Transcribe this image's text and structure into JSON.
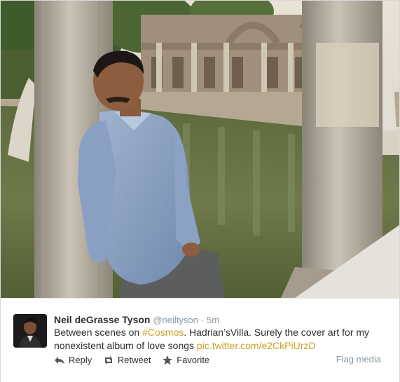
{
  "tweet": {
    "author_name": "Neil deGrasse Tyson",
    "handle": "@neiltyson",
    "separator": "·",
    "time": "5m",
    "text_before": "Between scenes on ",
    "hashtag": "#Cosmos",
    "text_middle": ". Hadrian’sVilla. Surely the cover art for my nonexistent album of love songs ",
    "link": "pic.twitter.com/e2CkPiUrzD"
  },
  "actions": {
    "reply": "Reply",
    "retweet": "Retweet",
    "favorite": "Favorite",
    "flag": "Flag media"
  },
  "icons": {
    "reply": "reply-icon",
    "retweet": "retweet-icon",
    "favorite": "star-icon"
  },
  "colors": {
    "link": "#c9a227",
    "name": "#292f33",
    "muted": "#8899a6"
  }
}
